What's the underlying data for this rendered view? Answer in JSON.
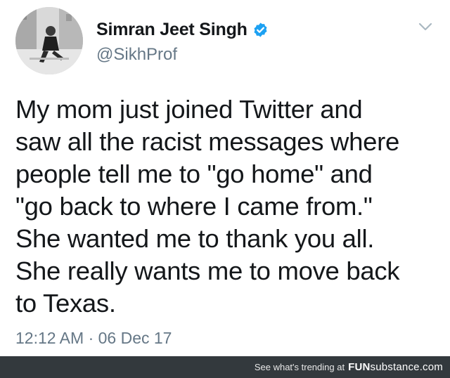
{
  "tweet": {
    "display_name": "Simran Jeet Singh",
    "handle": "@SikhProf",
    "verified": true,
    "text": "My mom just joined Twitter and\nsaw all the racist messages where\npeople tell me to \"go home\" and\n\"go back to where I came from.\"\nShe wanted me to thank you all.\nShe really wants me to move back\nto Texas.",
    "timestamp": "12:12 AM · 06 Dec 17",
    "icons": {
      "avatar": "profile-photo",
      "verified": "verified-badge-icon",
      "menu": "chevron-down-icon"
    }
  },
  "footer": {
    "text": "See what's trending at",
    "brand_prefix": "FUN",
    "brand_suffix": "substance.com"
  },
  "colors": {
    "name": "#14171a",
    "secondary": "#657786",
    "verified": "#1da1f2",
    "footer_bg": "#33393d"
  }
}
